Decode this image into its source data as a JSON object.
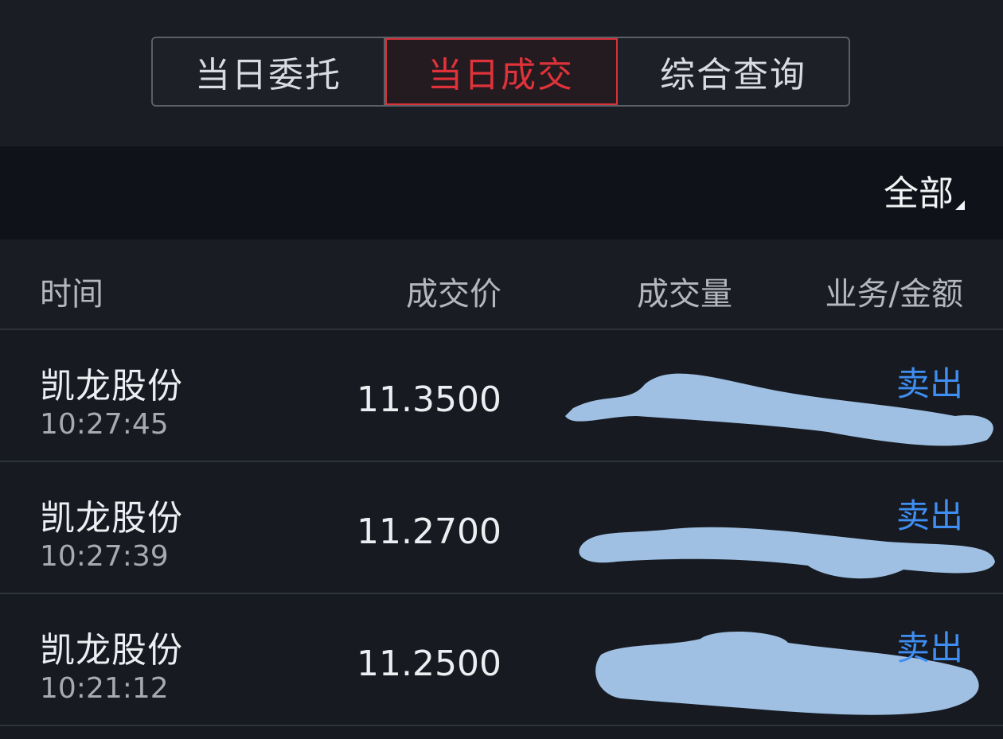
{
  "tabs": [
    {
      "label": "当日委托",
      "active": false
    },
    {
      "label": "当日成交",
      "active": true
    },
    {
      "label": "综合查询",
      "active": false
    }
  ],
  "filter": {
    "label": "全部"
  },
  "columns": {
    "time": "时间",
    "price": "成交价",
    "volume": "成交量",
    "business": "业务/金额"
  },
  "trades": [
    {
      "name": "凯龙股份",
      "time": "10:27:45",
      "price": "11.3500",
      "business": "卖出"
    },
    {
      "name": "凯龙股份",
      "time": "10:27:39",
      "price": "11.2700",
      "business": "卖出"
    },
    {
      "name": "凯龙股份",
      "time": "10:21:12",
      "price": "11.2500",
      "business": "卖出"
    }
  ],
  "colors": {
    "accent": "#e0323a",
    "sell": "#3f8ef2",
    "redaction": "#9fc0e3"
  }
}
